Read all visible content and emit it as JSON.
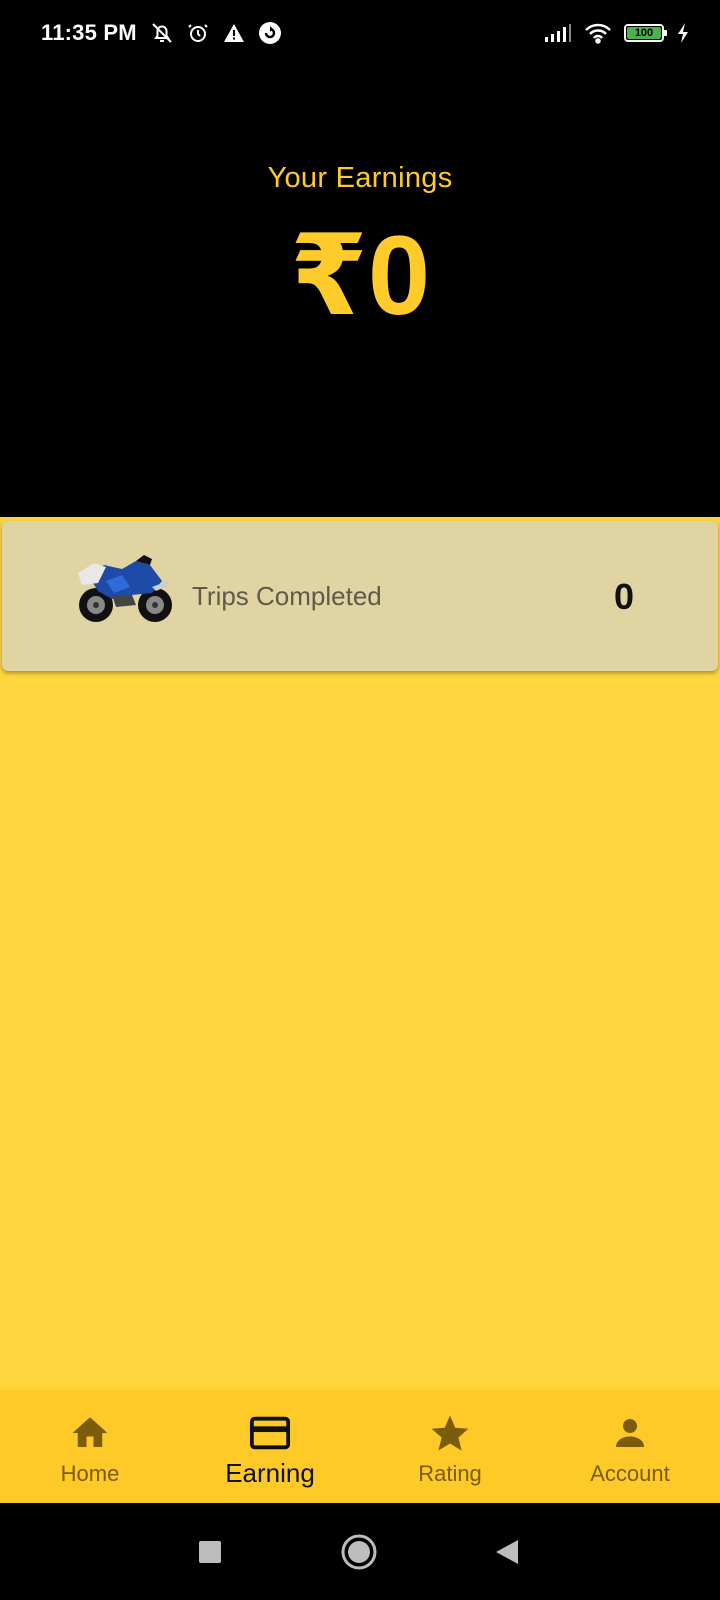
{
  "status_bar": {
    "time": "11:35 PM",
    "battery": "100",
    "icons": [
      "bell-off-icon",
      "alarm-icon",
      "warning-icon",
      "sync-icon",
      "signal-icon",
      "wifi-icon",
      "battery-icon",
      "charging-icon"
    ]
  },
  "earnings": {
    "title": "Your Earnings",
    "amount": "₹0"
  },
  "trips_card": {
    "image": "motorcycle-icon",
    "label": "Trips Completed",
    "value": "0"
  },
  "bottom_nav": {
    "items": [
      {
        "label": "Home",
        "icon": "home-icon",
        "active": false
      },
      {
        "label": "Earning",
        "icon": "card-icon",
        "active": true
      },
      {
        "label": "Rating",
        "icon": "star-icon",
        "active": false
      },
      {
        "label": "Account",
        "icon": "person-icon",
        "active": false
      }
    ]
  },
  "system_nav": {
    "buttons": [
      "recents-button",
      "home-button",
      "back-button"
    ]
  },
  "colors": {
    "accent": "#ffcb2b",
    "content_background": "#ffd53d",
    "card_background": "#e0d4a2",
    "nav_background": "#ffca28",
    "nav_inactive": "#7a5c0b",
    "header_background": "#000000"
  }
}
